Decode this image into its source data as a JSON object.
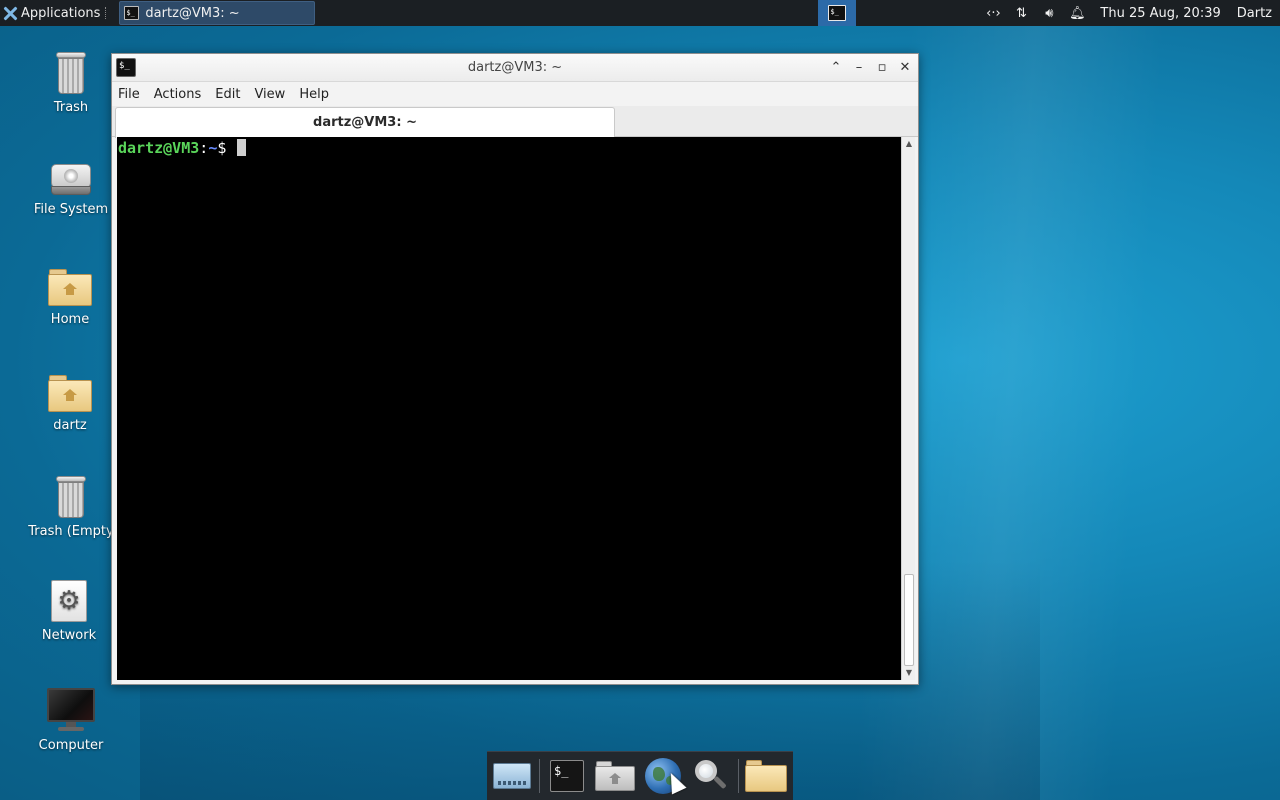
{
  "top_panel": {
    "applications_label": "Applications",
    "taskbar_window_title": "dartz@VM3: ~",
    "clock": "Thu 25 Aug, 20:39",
    "user": "Dartz",
    "tray_icons": [
      "network-activity-icon",
      "updown-arrows-icon",
      "volume-icon",
      "notification-bell-icon"
    ]
  },
  "desktop": {
    "icons": [
      {
        "name": "trash",
        "label": "Trash",
        "icon": "trash-icon"
      },
      {
        "name": "file-system",
        "label": "File System",
        "icon": "drive-icon"
      },
      {
        "name": "home",
        "label": "Home",
        "icon": "home-folder-icon"
      },
      {
        "name": "dartz",
        "label": "dartz",
        "icon": "home-folder-icon"
      },
      {
        "name": "trash-empty",
        "label": "Trash (Empty",
        "icon": "trash-icon"
      },
      {
        "name": "network",
        "label": "Network",
        "icon": "gear-icon"
      },
      {
        "name": "computer",
        "label": "Computer",
        "icon": "monitor-icon"
      }
    ]
  },
  "terminal": {
    "window_title": "dartz@VM3: ~",
    "menu": [
      "File",
      "Actions",
      "Edit",
      "View",
      "Help"
    ],
    "tab_label": "dartz@VM3: ~",
    "prompt_user_host": "dartz@VM3",
    "prompt_colon": ":",
    "prompt_path": "~",
    "prompt_symbol": "$"
  },
  "dock": {
    "items": [
      "show-desktop-icon",
      "terminal-icon",
      "home-folder-icon",
      "web-browser-icon",
      "app-finder-icon",
      "file-manager-icon"
    ]
  },
  "colors": {
    "prompt_user": "#5ad55a",
    "prompt_path": "#6a8cff",
    "panel_bg": "#1b1f23",
    "desktop_bg": "#1488b8"
  }
}
